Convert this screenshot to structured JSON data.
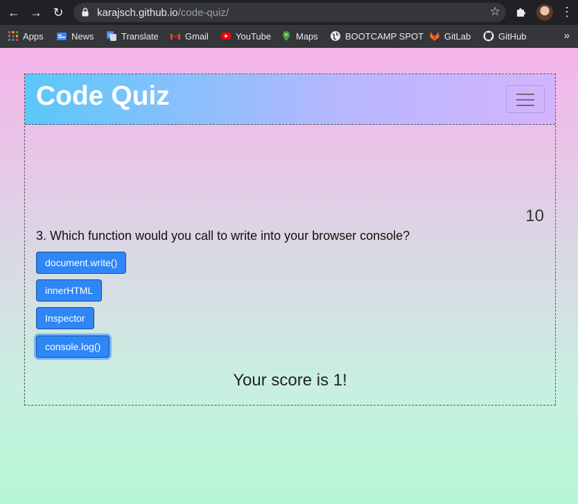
{
  "browser": {
    "url_host": "karajsch.github.io",
    "url_path": "/code-quiz/"
  },
  "bookmarks": [
    {
      "label": "Apps",
      "icon": "apps-grid-icon"
    },
    {
      "label": "News",
      "icon": "google-news-icon"
    },
    {
      "label": "Translate",
      "icon": "google-translate-icon"
    },
    {
      "label": "Gmail",
      "icon": "gmail-icon"
    },
    {
      "label": "YouTube",
      "icon": "youtube-icon"
    },
    {
      "label": "Maps",
      "icon": "maps-pin-icon"
    },
    {
      "label": "BOOTCAMP SPOT",
      "icon": "globe-icon"
    },
    {
      "label": "GitLab",
      "icon": "gitlab-icon"
    },
    {
      "label": "GitHub",
      "icon": "github-icon"
    }
  ],
  "quiz": {
    "title": "Code Quiz",
    "timer": "10",
    "question": "3. Which function would you call to write into your browser console?",
    "answers": [
      "document.write()",
      "innerHTML",
      "Inspector",
      "console.log()"
    ],
    "score_text": "Your score is 1!"
  },
  "colors": {
    "header_gradient_start": "#5ac8fa",
    "header_gradient_end": "#d3b4fd",
    "button_blue": "#2f86f6",
    "page_top": "#f5b3ea",
    "page_bottom": "#b5f7d5"
  }
}
